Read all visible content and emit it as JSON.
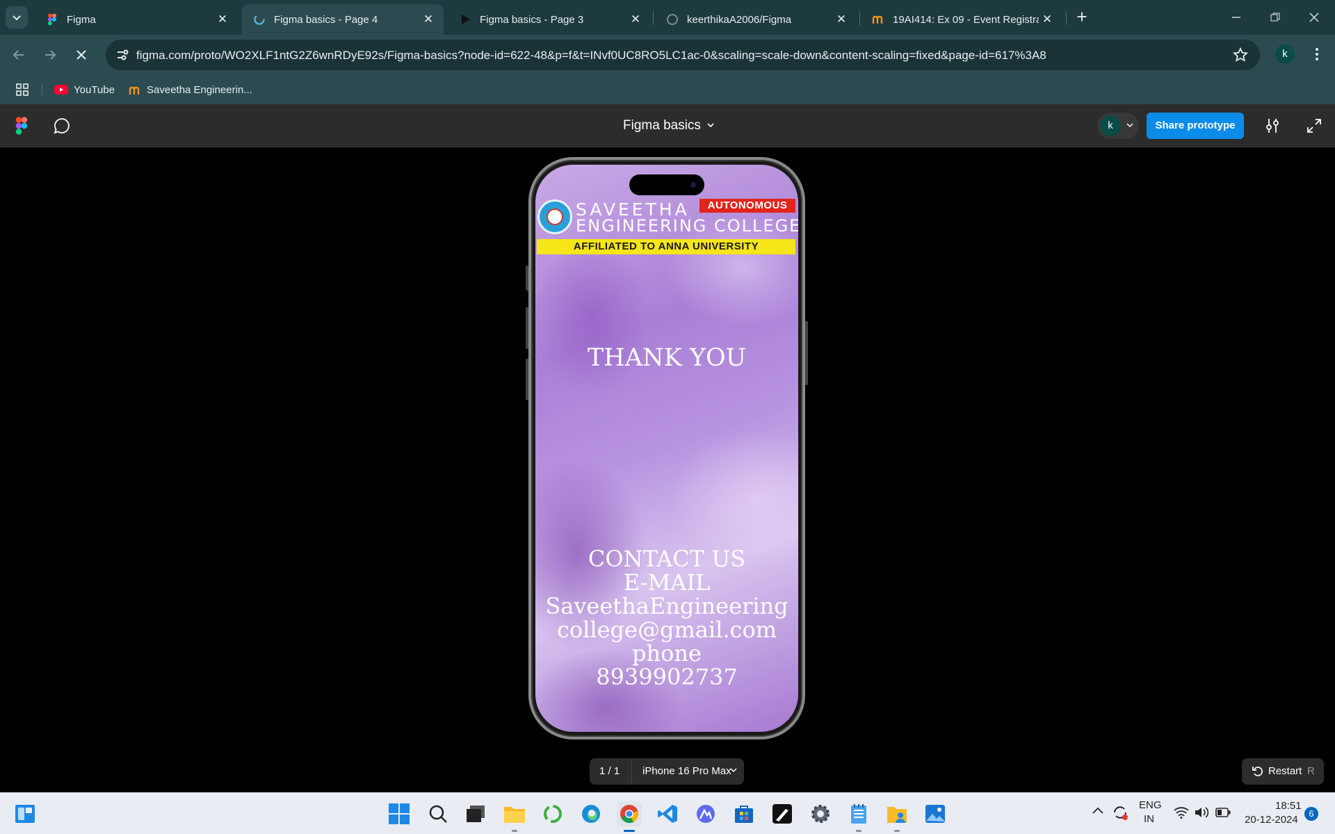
{
  "browser": {
    "tabs": [
      {
        "title": "Figma",
        "favicon": "figma-icon",
        "active": false
      },
      {
        "title": "Figma basics - Page 4",
        "favicon": "loading-icon",
        "active": true
      },
      {
        "title": "Figma basics - Page 3",
        "favicon": "play-icon",
        "active": false
      },
      {
        "title": "keerthikaA2006/Figma",
        "favicon": "github-icon",
        "active": false
      },
      {
        "title": "19AI414: Ex 09 - Event Registrat",
        "favicon": "moodle-icon",
        "active": false
      }
    ],
    "url": "figma.com/proto/WO2XLF1ntG2Z6wnRDyE92s/Figma-basics?node-id=622-48&p=f&t=INvf0UC8RO5LC1ac-0&scaling=scale-down&content-scaling=fixed&page-id=617%3A8",
    "profile_initial": "k",
    "bookmarks": [
      {
        "label": "YouTube",
        "icon": "youtube-icon"
      },
      {
        "label": "Saveetha Engineerin...",
        "icon": "moodle-icon"
      }
    ]
  },
  "figma": {
    "file_title": "Figma basics",
    "user_initial": "k",
    "share_label": "Share prototype",
    "page_counter": "1 / 1",
    "device_label": "iPhone 16 Pro Max",
    "restart_label": "Restart",
    "restart_key": "R",
    "accent": "#0c8ce9"
  },
  "screen": {
    "college_line1": "SAVEETHA",
    "college_line2": "ENGINEERING COLLEGE",
    "autonomous": "AUTONOMOUS",
    "affiliated": "AFFILIATED TO ANNA UNIVERSITY",
    "thank_you": "THANK YOU",
    "contact_lines": [
      "CONTACT US",
      "E-MAIL",
      "SaveethaEngineering",
      "college@gmail.com",
      "phone",
      "8939902737"
    ]
  },
  "taskbar": {
    "language_top": "ENG",
    "language_bottom": "IN",
    "time": "18:51",
    "date": "20-12-2024",
    "notification_count": "6"
  }
}
